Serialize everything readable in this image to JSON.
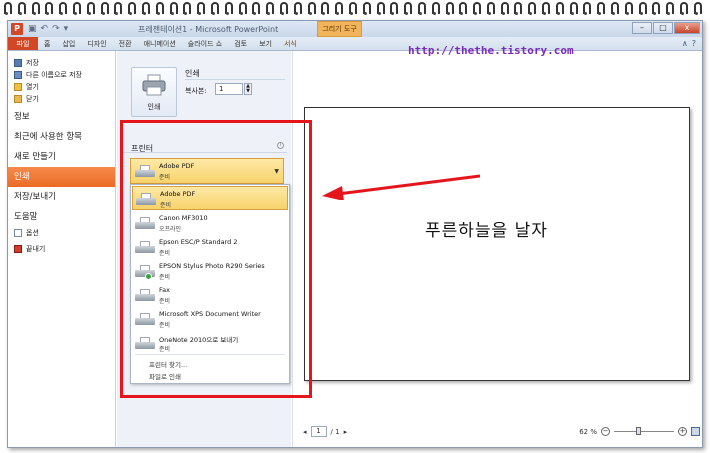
{
  "window": {
    "app_icon": "P",
    "title": "프레젠테이션1 - Microsoft PowerPoint",
    "tools_tab": "그리기 도구",
    "minimize": "–",
    "maximize": "□",
    "close": "x"
  },
  "ribbon": {
    "file_tab": "파일",
    "tabs": [
      "홈",
      "삽입",
      "디자인",
      "전환",
      "애니메이션",
      "슬라이드 쇼",
      "검토",
      "보기"
    ],
    "format_tab": "서식"
  },
  "watermark": "http://thethe.tistory.com",
  "nav": {
    "small_items": [
      {
        "label": "저장",
        "icon": "save-icon"
      },
      {
        "label": "다른 이름으로 저장",
        "icon": "save-as-icon"
      },
      {
        "label": "열기",
        "icon": "open-folder-icon"
      },
      {
        "label": "닫기",
        "icon": "close-folder-icon"
      }
    ],
    "big_items": [
      "정보",
      "최근에 사용한 항목",
      "새로 만들기",
      "인쇄",
      "저장/보내기",
      "도움말"
    ],
    "active": "인쇄",
    "bottom_items": [
      {
        "label": "옵션",
        "icon": "options-icon"
      },
      {
        "label": "끝내기",
        "icon": "exit-icon"
      }
    ]
  },
  "print": {
    "section_title": "인쇄",
    "button_label": "인쇄",
    "copies_label": "복사본:",
    "copies_value": "1",
    "printer_section": "프린터",
    "selected_printer": {
      "name": "Adobe PDF",
      "status": "준비"
    },
    "printers": [
      {
        "name": "Adobe PDF",
        "status": "준비"
      },
      {
        "name": "Canon MF3010",
        "status": "오프라인"
      },
      {
        "name": "Epson ESC/P Standard 2",
        "status": "준비"
      },
      {
        "name": "EPSON Stylus Photo R290 Series",
        "status": "준비"
      },
      {
        "name": "Fax",
        "status": "준비"
      },
      {
        "name": "Microsoft XPS Document Writer",
        "status": "준비"
      },
      {
        "name": "OneNote 2010으로 보내기",
        "status": "준비"
      }
    ],
    "find_printer": "프린터 찾기...",
    "print_to_file": "파일로 인쇄"
  },
  "preview": {
    "slide_text": "푸른하늘을 날자",
    "page_current": "1",
    "page_total": "/ 1",
    "zoom_label": "62 %"
  },
  "colors": {
    "accent_orange": "#ea6b26",
    "annotation_red": "#e4161c",
    "watermark_purple": "#7a2bb8",
    "selection_yellow": "#f8d36a"
  }
}
